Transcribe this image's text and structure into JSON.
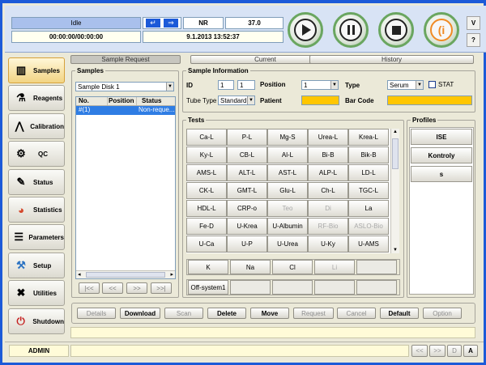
{
  "status": {
    "state": "Idle",
    "mode": "NR",
    "temperature": "37.0",
    "elapsed": "00:00:00/00:00:00",
    "datetime": "9.1.2013 13:52:37"
  },
  "colors": {
    "accent": "#1c5ad8",
    "status_highlight": "#a9c0ec",
    "yellow_field": "#ffc600",
    "selection": "#2f7de4"
  },
  "top_right": {
    "version_label": "V",
    "help_label": "?"
  },
  "sidebar": {
    "items": [
      {
        "label": "Samples",
        "icon": "tube-rack-icon"
      },
      {
        "label": "Reagents",
        "icon": "bottle-icon"
      },
      {
        "label": "Calibration",
        "icon": "compass-icon"
      },
      {
        "label": "QC",
        "icon": "microscope-icon"
      },
      {
        "label": "Status",
        "icon": "pencil-icon"
      },
      {
        "label": "Statistics",
        "icon": "pie-chart-icon"
      },
      {
        "label": "Parameters",
        "icon": "list-icon"
      },
      {
        "label": "Setup",
        "icon": "tools-icon"
      },
      {
        "label": "Utilities",
        "icon": "wrench-icon"
      },
      {
        "label": "Shutdown",
        "icon": "power-icon"
      }
    ]
  },
  "tabs": [
    "Sample Request",
    "Current",
    "History"
  ],
  "samples_panel": {
    "title": "Samples",
    "disk": "Sample Disk 1",
    "columns": [
      "No.",
      "Position",
      "Status"
    ],
    "rows": [
      {
        "no": "#(1)",
        "position": "",
        "status": "Non-reque..."
      }
    ],
    "nav": [
      "|<<",
      "<<",
      ">>",
      ">>|"
    ]
  },
  "sample_info": {
    "title": "Sample Information",
    "id_label": "ID",
    "id1": "1",
    "id2": "1",
    "position_label": "Position",
    "position_value": "1",
    "type_label": "Type",
    "type_value": "Serum",
    "stat_label": "STAT",
    "tube_label": "Tube Type",
    "tube_value": "Standard",
    "patient_label": "Patient",
    "barcode_label": "Bar Code"
  },
  "tests": {
    "title": "Tests",
    "buttons": [
      {
        "label": "Ca-L",
        "enabled": true
      },
      {
        "label": "P-L",
        "enabled": true
      },
      {
        "label": "Mg-S",
        "enabled": true
      },
      {
        "label": "Urea-L",
        "enabled": true
      },
      {
        "label": "Krea-L",
        "enabled": true
      },
      {
        "label": "Ky-L",
        "enabled": true
      },
      {
        "label": "CB-L",
        "enabled": true
      },
      {
        "label": "Al-L",
        "enabled": true
      },
      {
        "label": "Bi-B",
        "enabled": true
      },
      {
        "label": "Bik-B",
        "enabled": true
      },
      {
        "label": "AMS-L",
        "enabled": true
      },
      {
        "label": "ALT-L",
        "enabled": true
      },
      {
        "label": "AST-L",
        "enabled": true
      },
      {
        "label": "ALP-L",
        "enabled": true
      },
      {
        "label": "LD-L",
        "enabled": true
      },
      {
        "label": "CK-L",
        "enabled": true
      },
      {
        "label": "GMT-L",
        "enabled": true
      },
      {
        "label": "Glu-L",
        "enabled": true
      },
      {
        "label": "Ch-L",
        "enabled": true
      },
      {
        "label": "TGC-L",
        "enabled": true
      },
      {
        "label": "HDL-L",
        "enabled": true
      },
      {
        "label": "CRP-o",
        "enabled": true
      },
      {
        "label": "Teo",
        "enabled": false
      },
      {
        "label": "Di",
        "enabled": false
      },
      {
        "label": "La",
        "enabled": true
      },
      {
        "label": "Fe-D",
        "enabled": true
      },
      {
        "label": "U-Krea",
        "enabled": true
      },
      {
        "label": "U-Albumin",
        "enabled": true
      },
      {
        "label": "RF-Bio",
        "enabled": false
      },
      {
        "label": "ASLO-Bio",
        "enabled": false
      },
      {
        "label": "U-Ca",
        "enabled": true
      },
      {
        "label": "U-P",
        "enabled": true
      },
      {
        "label": "U-Urea",
        "enabled": true
      },
      {
        "label": "U-Ky",
        "enabled": true
      },
      {
        "label": "U-AMS",
        "enabled": true
      }
    ],
    "ise": [
      {
        "label": "K",
        "enabled": true
      },
      {
        "label": "Na",
        "enabled": true
      },
      {
        "label": "Cl",
        "enabled": true
      },
      {
        "label": "Li",
        "enabled": false
      },
      {
        "label": "",
        "enabled": false
      }
    ],
    "offsystem": [
      "Off-system1",
      "",
      "",
      "",
      ""
    ]
  },
  "profiles": {
    "title": "Profiles",
    "items": [
      "ISE",
      "Kontroly",
      "s"
    ]
  },
  "actions": [
    {
      "label": "Details",
      "enabled": false
    },
    {
      "label": "Download",
      "enabled": true
    },
    {
      "label": "Scan",
      "enabled": false
    },
    {
      "label": "Delete",
      "enabled": true
    },
    {
      "label": "Move",
      "enabled": true
    },
    {
      "label": "Request",
      "enabled": false
    },
    {
      "label": "Cancel",
      "enabled": false
    },
    {
      "label": "Default",
      "enabled": true
    },
    {
      "label": "Option",
      "enabled": false
    }
  ],
  "footer": {
    "user": "ADMIN",
    "nav": [
      "<<",
      ">>",
      "D",
      "A"
    ]
  }
}
